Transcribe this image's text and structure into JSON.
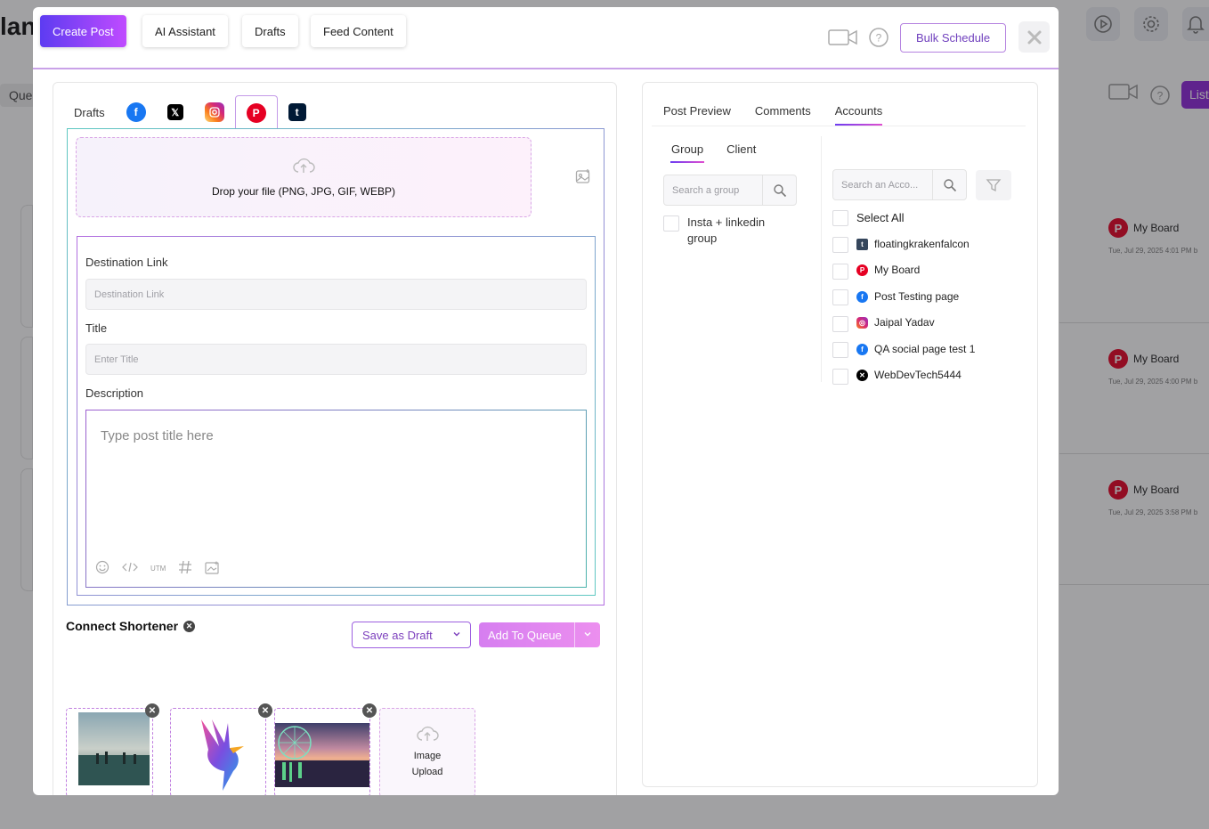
{
  "background": {
    "title": "lan",
    "queue_tab": "Que",
    "list_button": "List",
    "cards": [
      {
        "account": "My Board",
        "date": "Tue, Jul 29, 2025 4:01 PM b"
      },
      {
        "account": "My Board",
        "date": "Tue, Jul 29, 2025 4:00 PM b"
      },
      {
        "account": "My Board",
        "date": "Tue, Jul 29, 2025 3:58 PM b"
      }
    ]
  },
  "header": {
    "tabs": [
      {
        "label": "Create Post",
        "active": true
      },
      {
        "label": "AI Assistant",
        "active": false
      },
      {
        "label": "Drafts",
        "active": false
      },
      {
        "label": "Feed Content",
        "active": false
      }
    ],
    "bulk_schedule": "Bulk Schedule",
    "icons": [
      "video-camera-icon",
      "help-icon",
      "close-icon"
    ]
  },
  "editor": {
    "platform_tabs": {
      "drafts_label": "Drafts",
      "platforms": [
        "facebook",
        "x",
        "instagram",
        "pinterest",
        "tumblr"
      ],
      "selected": "pinterest"
    },
    "dropzone_text": "Drop your file (PNG, JPG, GIF, WEBP)",
    "destination_link": {
      "label": "Destination Link",
      "placeholder": "Destination Link"
    },
    "title_field": {
      "label": "Title",
      "placeholder": "Enter Title"
    },
    "description": {
      "label": "Description",
      "placeholder": "Type post title here"
    },
    "toolbar_utm": "UTM",
    "shortener_label": "Connect Shortener",
    "save_draft": "Save as Draft",
    "add_to_queue": "Add To Queue",
    "image_upload": [
      "Image",
      "Upload"
    ]
  },
  "right_panel": {
    "tabs": [
      {
        "label": "Post Preview",
        "active": false
      },
      {
        "label": "Comments",
        "active": false
      },
      {
        "label": "Accounts",
        "active": true
      }
    ],
    "group_tabs": [
      {
        "label": "Group",
        "active": true
      },
      {
        "label": "Client",
        "active": false
      }
    ],
    "group_search_placeholder": "Search a group",
    "account_search_placeholder": "Search an Acco...",
    "groups": [
      "Insta + linkedin group"
    ],
    "select_all": "Select All",
    "accounts": [
      {
        "name": "floatingkrakenfalcon",
        "platform": "tumblr",
        "color": "#35465c"
      },
      {
        "name": "My Board",
        "platform": "pinterest",
        "color": "#e60023"
      },
      {
        "name": "Post Testing page",
        "platform": "facebook",
        "color": "#1877f2"
      },
      {
        "name": "Jaipal Yadav",
        "platform": "instagram",
        "color": "#d62976"
      },
      {
        "name": "QA social page test 1",
        "platform": "facebook",
        "color": "#1877f2"
      },
      {
        "name": "WebDevTech5444",
        "platform": "x",
        "color": "#000000"
      }
    ]
  }
}
